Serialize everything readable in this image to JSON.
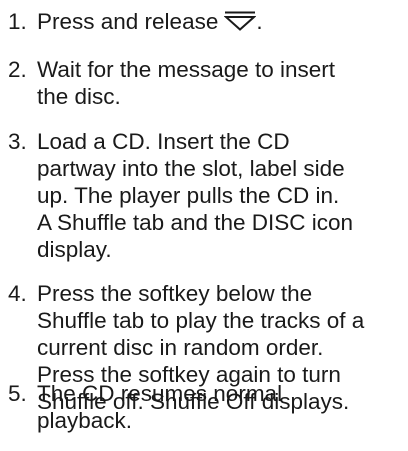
{
  "steps": [
    {
      "number": "1.",
      "lines": [
        "Press and release"
      ],
      "trailing_icon": "eject-icon",
      "trailing_text": "."
    },
    {
      "number": "2.",
      "lines": [
        "Wait for the message to insert",
        "the disc."
      ]
    },
    {
      "number": "3.",
      "lines": [
        "Load a CD. Insert the CD",
        "partway into the slot, label side",
        "up. The player pulls the CD in.",
        "A Shuffle tab and the DISC icon",
        "display."
      ]
    },
    {
      "number": "4.",
      "lines": [
        "Press the softkey below the",
        "Shuffle tab to play the tracks of a",
        "current disc in random order.",
        "Press the softkey again to turn",
        "Shuffle off. Shuffle Off displays."
      ]
    },
    {
      "number": "5.",
      "lines": [
        "The CD resumes normal",
        "playback."
      ]
    }
  ]
}
